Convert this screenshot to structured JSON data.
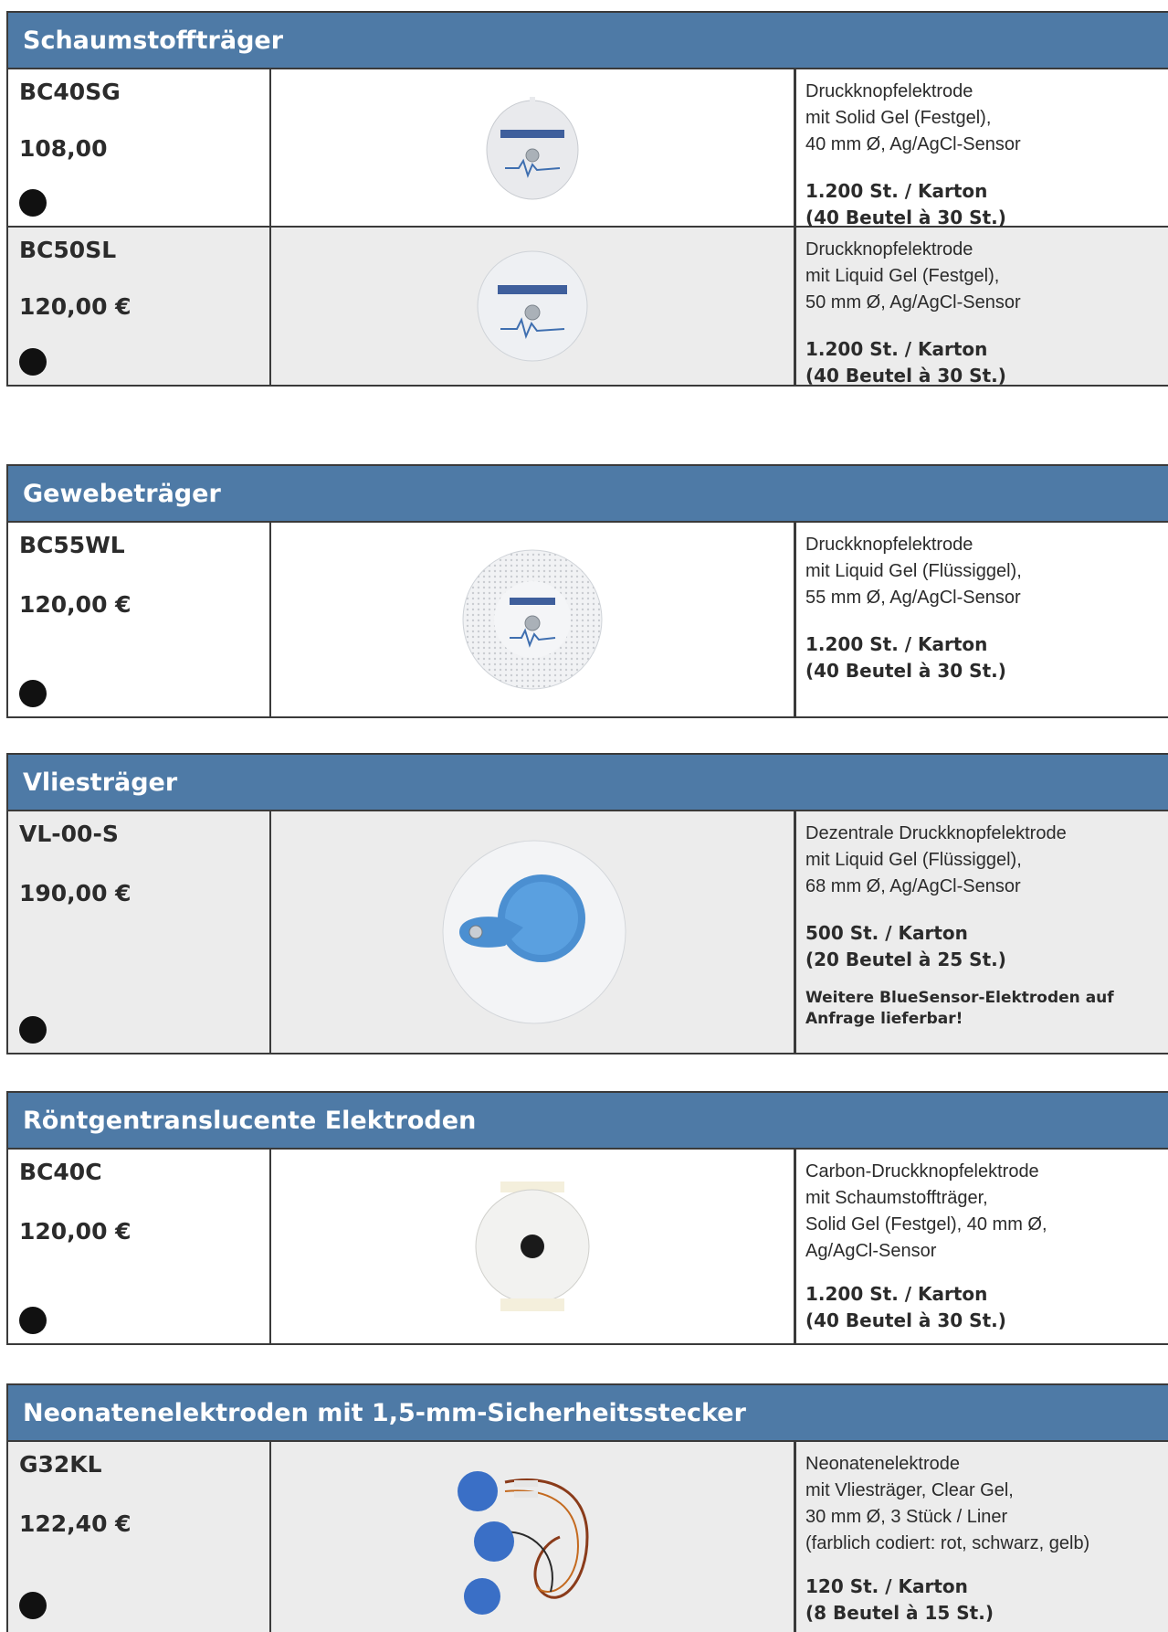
{
  "sections": [
    {
      "title": "Schaumstoffträger",
      "rows": [
        {
          "code": "BC40SG",
          "price": "108,00",
          "desc": [
            "Druckknopfelektrode",
            "mit Solid Gel (Festgel),",
            "40 mm Ø, Ag/AgCl-Sensor"
          ],
          "qty": [
            "1.200 St. / Karton",
            "(40 Beutel à 30 St.)"
          ]
        },
        {
          "code": "BC50SL",
          "price": "120,00 €",
          "desc": [
            "Druckknopfelektrode",
            "mit Liquid Gel (Festgel),",
            "50 mm Ø, Ag/AgCl-Sensor"
          ],
          "qty": [
            "1.200 St. / Karton",
            "(40 Beutel à 30 St.)"
          ]
        }
      ]
    },
    {
      "title": "Gewebeträger",
      "rows": [
        {
          "code": "BC55WL",
          "price": "120,00 €",
          "desc": [
            "Druckknopfelektrode",
            "mit Liquid Gel (Flüssiggel),",
            "55 mm Ø, Ag/AgCl-Sensor"
          ],
          "qty": [
            "1.200 St. / Karton",
            "(40 Beutel à 30 St.)"
          ]
        }
      ]
    },
    {
      "title": "Vliesträger",
      "rows": [
        {
          "code": "VL-00-S",
          "price": "190,00 €",
          "desc": [
            "Dezentrale Druckknopfelektrode",
            "mit Liquid Gel (Flüssiggel),",
            "68 mm Ø, Ag/AgCl-Sensor"
          ],
          "qty": [
            "500 St. / Karton",
            "(20 Beutel à 25 St.)"
          ],
          "note": [
            "Weitere BlueSensor-Elektroden auf",
            "Anfrage lieferbar!"
          ]
        }
      ]
    },
    {
      "title": "Röntgentranslucente Elektroden",
      "rows": [
        {
          "code": "BC40C",
          "price": "120,00 €",
          "desc": [
            "Carbon-Druckknopfelektrode",
            "mit Schaumstoffträger,",
            "Solid Gel (Festgel), 40 mm Ø,",
            "Ag/AgCl-Sensor"
          ],
          "qty": [
            "1.200 St. / Karton",
            "(40 Beutel à 30 St.)"
          ]
        }
      ]
    },
    {
      "title": "Neonatenelektroden mit 1,5-mm-Sicherheitsstecker",
      "rows": [
        {
          "code": "G32KL",
          "price": "122,40 €",
          "desc": [
            "Neonatenelektrode",
            "mit Vliesträger, Clear Gel,",
            "30 mm Ø, 3 Stück / Liner",
            "(farblich codiert: rot, schwarz, gelb)"
          ],
          "qty": [
            "120 St. / Karton",
            "(8 Beutel à 15 St.)"
          ]
        }
      ]
    }
  ]
}
